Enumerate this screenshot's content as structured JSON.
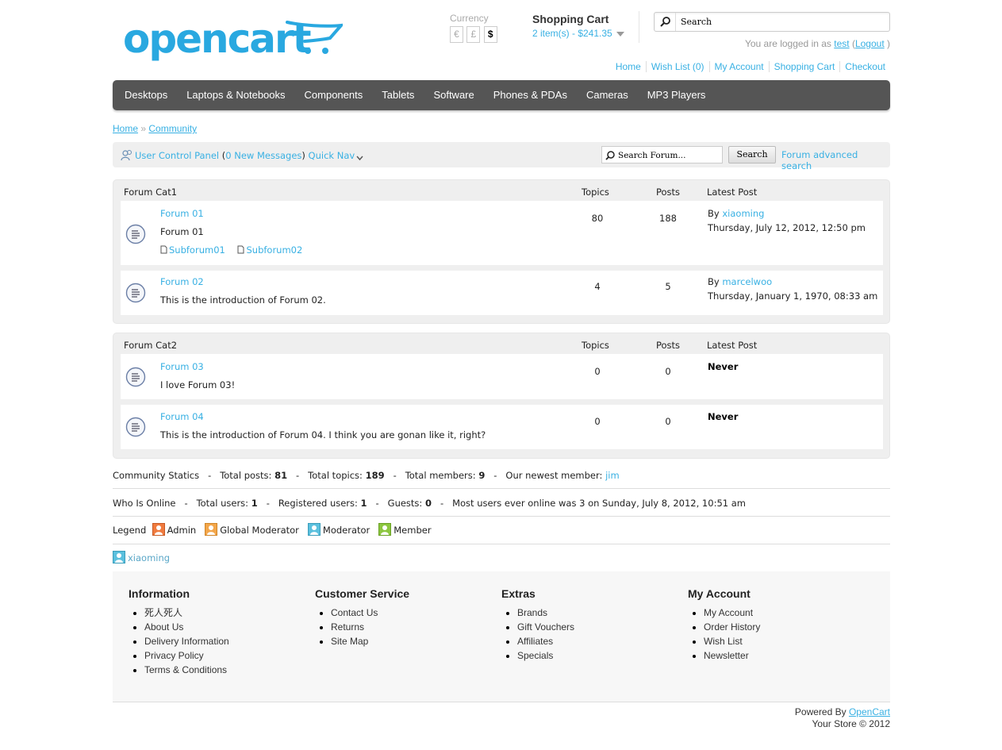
{
  "brand": {
    "logo_text": "opencart",
    "accent": "#29a8e0"
  },
  "currency": {
    "label": "Currency",
    "options": [
      "€",
      "£",
      "$"
    ],
    "selected": "$"
  },
  "cart": {
    "title": "Shopping Cart",
    "total": "2 item(s) - $241.35"
  },
  "search": {
    "placeholder": "Search",
    "value": "Search"
  },
  "welcome": {
    "prefix": "You are logged in as",
    "user": "test",
    "open": "(",
    "logout": "Logout",
    "close": ")"
  },
  "top_links": [
    "Home",
    "Wish List (0)",
    "My Account",
    "Shopping Cart",
    "Checkout"
  ],
  "menu": [
    "Desktops",
    "Laptops & Notebooks",
    "Components",
    "Tablets",
    "Software",
    "Phones & PDAs",
    "Cameras",
    "MP3 Players"
  ],
  "breadcrumb": {
    "home": "Home",
    "sep": "»",
    "current": "Community"
  },
  "forum_nav": {
    "ucp": "User Control Panel",
    "paren_open": "(",
    "messages": "0 New Messages",
    "paren_close": ")",
    "quick_nav": "Quick Nav",
    "search_value": "Search Forum...",
    "search_button": "Search",
    "advanced": "Forum advanced search"
  },
  "columns": {
    "topics": "Topics",
    "posts": "Posts",
    "latest": "Latest Post"
  },
  "categories": [
    {
      "name": "Forum Cat1",
      "forums": [
        {
          "name": "Forum 01",
          "desc": "Forum 01",
          "subforums": [
            "Subforum01",
            "Subforum02"
          ],
          "topics": "80",
          "posts": "188",
          "by": "By",
          "author": "xiaoming",
          "date": "Thursday, July 12, 2012, 12:50 pm"
        },
        {
          "name": "Forum 02",
          "desc": "This is the introduction of Forum 02.",
          "topics": "4",
          "posts": "5",
          "by": "By",
          "author": "marcelwoo",
          "date": "Thursday, January 1, 1970, 08:33 am"
        }
      ]
    },
    {
      "name": "Forum Cat2",
      "forums": [
        {
          "name": "Forum 03",
          "desc": "I love Forum 03!",
          "topics": "0",
          "posts": "0",
          "latest": "Never"
        },
        {
          "name": "Forum 04",
          "desc": "This is the introduction of Forum 04. I think you are gonan like it, right?",
          "topics": "0",
          "posts": "0",
          "latest": "Never"
        }
      ]
    }
  ],
  "stats": {
    "label": "Community Statics",
    "sep": "-",
    "posts_label": "Total posts:",
    "posts": "81",
    "topics_label": "Total topics:",
    "topics": "189",
    "members_label": "Total members:",
    "members": "9",
    "newest_label": "Our newest member:",
    "newest": "jim"
  },
  "online": {
    "label": "Who Is Online",
    "users_label": "Total users:",
    "users": "1",
    "registered_label": "Registered users:",
    "registered": "1",
    "guests_label": "Guests:",
    "guests": "0",
    "most": "Most users ever online was 3 on Sunday, July 8, 2012, 10:51 am"
  },
  "legend": {
    "label": "Legend",
    "items": [
      {
        "name": "Admin",
        "color": "#f07b3f"
      },
      {
        "name": "Global Moderator",
        "color": "#f3a64a"
      },
      {
        "name": "Moderator",
        "color": "#5bc0de"
      },
      {
        "name": "Member",
        "color": "#8cc63f"
      }
    ]
  },
  "online_users": [
    "xiaoming"
  ],
  "footer": {
    "columns": [
      {
        "title": "Information",
        "items": [
          "死人死人",
          "About Us",
          "Delivery Information",
          "Privacy Policy",
          "Terms & Conditions"
        ]
      },
      {
        "title": "Customer Service",
        "items": [
          "Contact Us",
          "Returns",
          "Site Map"
        ]
      },
      {
        "title": "Extras",
        "items": [
          "Brands",
          "Gift Vouchers",
          "Affiliates",
          "Specials"
        ]
      },
      {
        "title": "My Account",
        "items": [
          "My Account",
          "Order History",
          "Wish List",
          "Newsletter"
        ]
      }
    ],
    "powered_prefix": "Powered By",
    "powered_link": "OpenCart",
    "copyright": "Your Store © 2012"
  }
}
